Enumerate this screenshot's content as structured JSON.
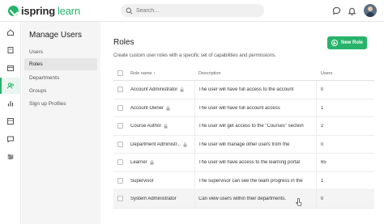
{
  "app": {
    "logo_main": "ispring",
    "logo_accent": "learn"
  },
  "search": {
    "placeholder": "Search..."
  },
  "sidebar": {
    "title": "Manage Users",
    "items": [
      {
        "label": "Users",
        "active": false
      },
      {
        "label": "Roles",
        "active": true
      },
      {
        "label": "Departments",
        "active": false
      },
      {
        "label": "Groups",
        "active": false
      },
      {
        "label": "Sign up Profiles",
        "active": false
      }
    ]
  },
  "rail": {
    "icons": [
      "home-icon",
      "courses-icon",
      "calendar-icon",
      "users-icon",
      "reports-icon",
      "content-icon",
      "messages-icon",
      "settings-icon"
    ],
    "active": "users-icon"
  },
  "main": {
    "title": "Roles",
    "new_button": "New Role",
    "subtitle": "Create custom user roles with a specific set of capabilities and permissions.",
    "columns": {
      "name": "Role name ↑",
      "description": "Description",
      "users": "Users"
    },
    "rows": [
      {
        "name": "Account Administrator",
        "locked": true,
        "description": "The user will have full access to the account",
        "users": "0"
      },
      {
        "name": "Account Owner",
        "locked": true,
        "description": "The user will have full account access",
        "users": "1"
      },
      {
        "name": "Course Author",
        "locked": true,
        "description": "The user will get access to the \"Courses\" section",
        "users": "2"
      },
      {
        "name": "Department Administr...",
        "locked": true,
        "description": "The user will manage other users from the",
        "users": "0"
      },
      {
        "name": "Learner",
        "locked": true,
        "description": "The user will have access to the learning portal",
        "users": "65"
      },
      {
        "name": "Supervisor",
        "locked": false,
        "description": "The supervisor can see the team progress in the",
        "users": "1"
      },
      {
        "name": "System Administrator",
        "locked": false,
        "description": "Can view users within their departments.",
        "users": "0"
      }
    ]
  },
  "colors": {
    "accent": "#27b36a",
    "sidebar_bg": "#f5f5f5"
  }
}
